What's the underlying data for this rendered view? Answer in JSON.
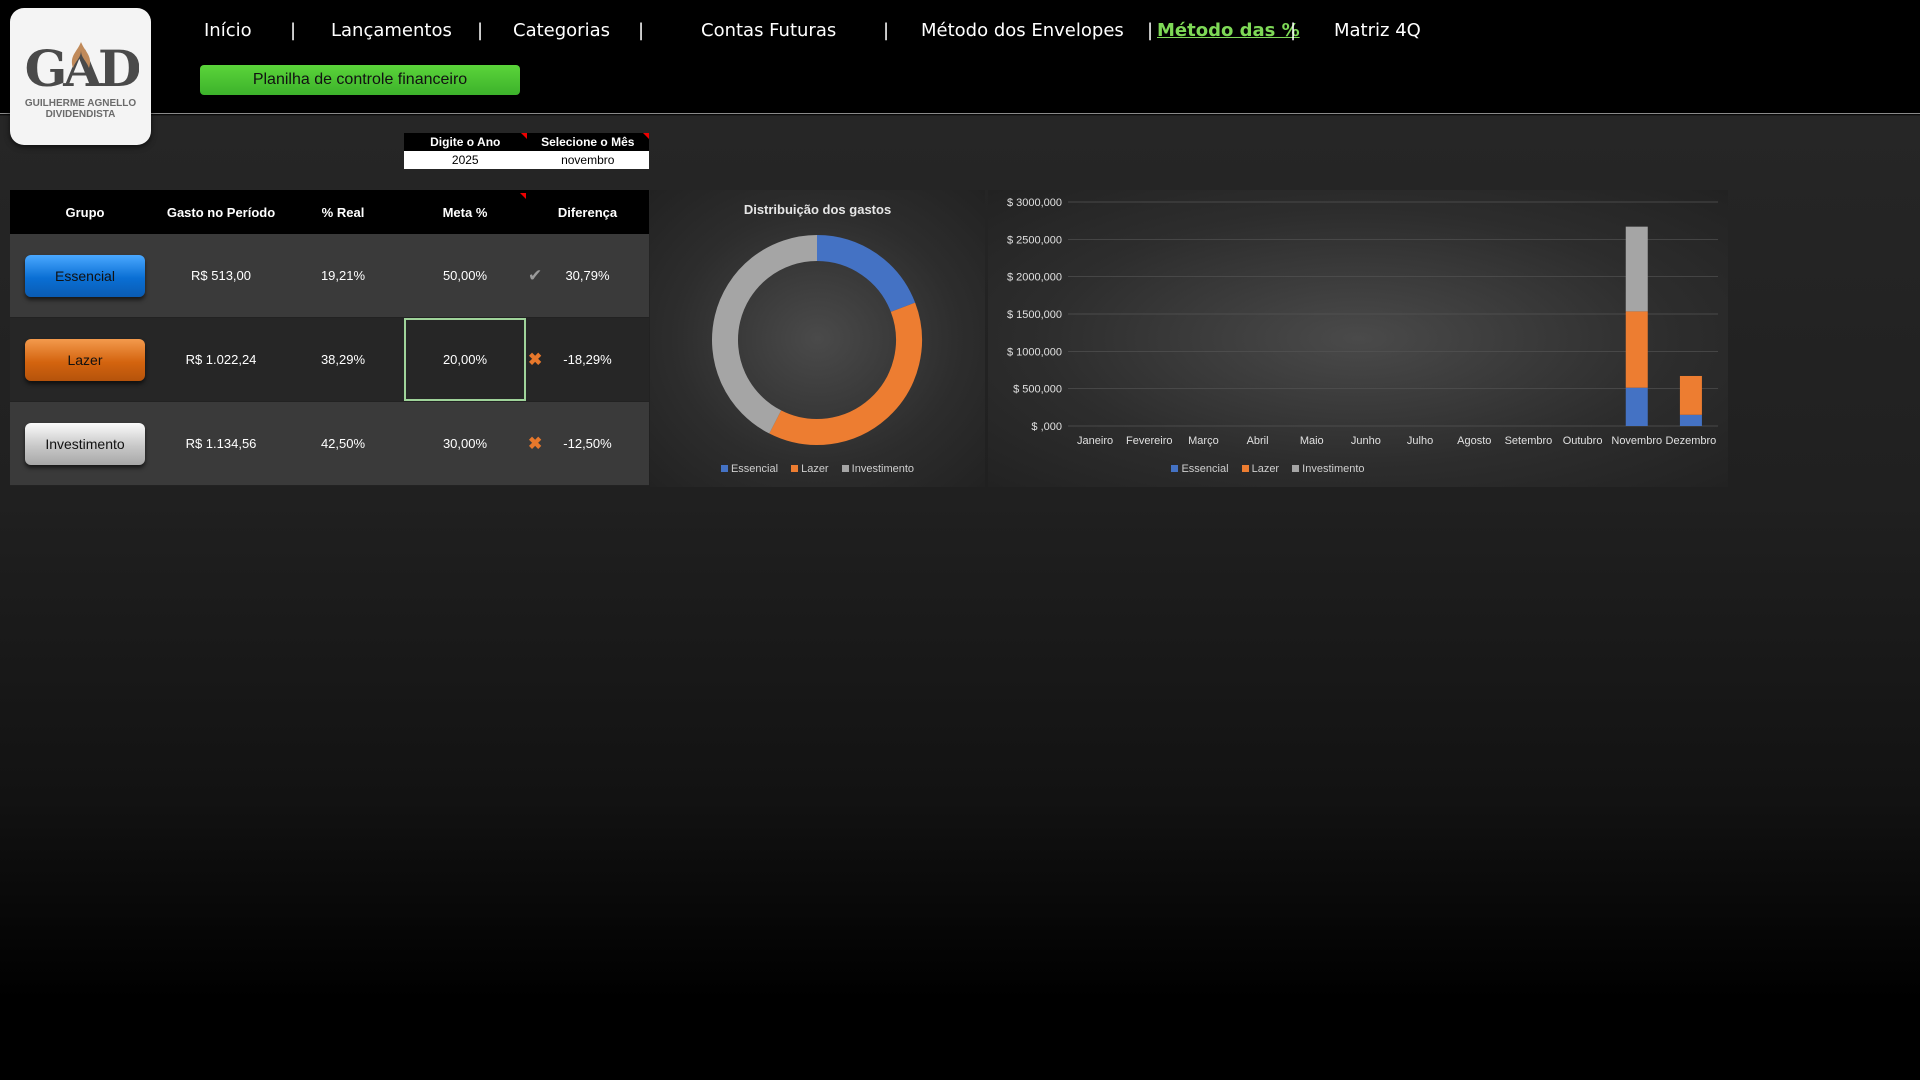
{
  "nav": {
    "items": [
      "Início",
      "Lançamentos",
      "Categorias",
      "Contas Futuras",
      "Método dos Envelopes",
      "Método das %",
      "Matriz 4Q"
    ],
    "active": "Método das %",
    "separator": "|"
  },
  "logo": {
    "letters": "GAD",
    "line1": "GUILHERME AGNELLO",
    "line2": "DIVIDENDISTA"
  },
  "subtitle": "Planilha de controle financeiro",
  "filters": {
    "year_label": "Digite o Ano",
    "month_label": "Selecione o Mês",
    "year_value": "2025",
    "month_value": "novembro"
  },
  "table": {
    "headers": [
      "Grupo",
      "Gasto no Período",
      "% Real",
      "Meta %",
      "Diferença"
    ],
    "rows": [
      {
        "group": "Essencial",
        "spent": "R$ 513,00",
        "real": "19,21%",
        "goal": "50,00%",
        "mark": "check",
        "diff": "30,79%"
      },
      {
        "group": "Lazer",
        "spent": "R$ 1.022,24",
        "real": "38,29%",
        "goal": "20,00%",
        "mark": "cross",
        "diff": "-18,29%"
      },
      {
        "group": "Investimento",
        "spent": "R$ 1.134,56",
        "real": "42,50%",
        "goal": "30,00%",
        "mark": "cross",
        "diff": "-12,50%"
      }
    ]
  },
  "colors": {
    "essencial": "#4472c4",
    "lazer": "#ed7d31",
    "investimento": "#a5a5a5",
    "active_nav": "#7ed957"
  },
  "chart_data": [
    {
      "type": "pie",
      "title": "Distribuição dos gastos",
      "categories": [
        "Essencial",
        "Lazer",
        "Investimento"
      ],
      "values": [
        19.21,
        38.29,
        42.5
      ],
      "legend": "bottom"
    },
    {
      "type": "bar",
      "stacked": true,
      "categories": [
        "Janeiro",
        "Fevereiro",
        "Março",
        "Abril",
        "Maio",
        "Junho",
        "Julho",
        "Agosto",
        "Setembro",
        "Outubro",
        "Novembro",
        "Dezembro"
      ],
      "series": [
        {
          "name": "Essencial",
          "values": [
            0,
            0,
            0,
            0,
            0,
            0,
            0,
            0,
            0,
            0,
            513,
            150
          ]
        },
        {
          "name": "Lazer",
          "values": [
            0,
            0,
            0,
            0,
            0,
            0,
            0,
            0,
            0,
            0,
            1022.24,
            520
          ]
        },
        {
          "name": "Investimento",
          "values": [
            0,
            0,
            0,
            0,
            0,
            0,
            0,
            0,
            0,
            0,
            1134.56,
            0
          ]
        }
      ],
      "yticks": [
        "$ ,000",
        "$ 500,000",
        "$ 1000,000",
        "$ 1500,000",
        "$ 2000,000",
        "$ 2500,000",
        "$ 3000,000"
      ],
      "ylim": [
        0,
        3000
      ],
      "legend": "bottom",
      "grid": true
    }
  ]
}
